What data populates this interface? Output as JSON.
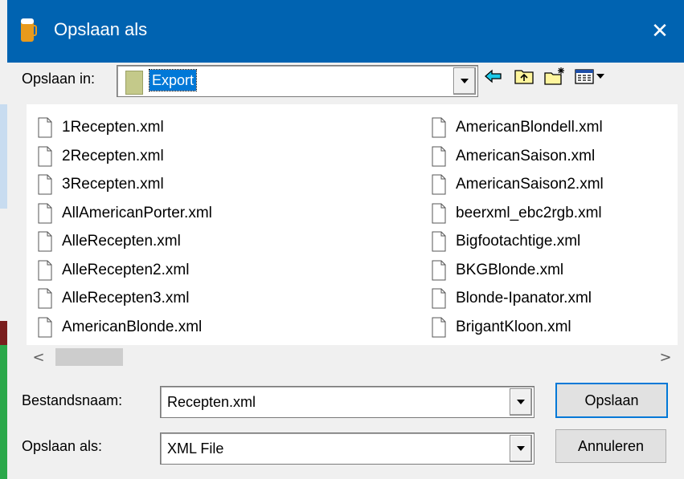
{
  "window": {
    "title": "Opslaan als",
    "close_glyph": "✕"
  },
  "colors": {
    "titlebar": "#0063b1",
    "selection": "#0078d7"
  },
  "location": {
    "label": "Opslaan in:",
    "folder_icon": "folder-icon",
    "current_folder": "Export"
  },
  "toolbar": {
    "icons": [
      "back-arrow-icon",
      "up-folder-icon",
      "new-folder-icon",
      "view-menu-icon"
    ]
  },
  "files": {
    "left": [
      "1Recepten.xml",
      "2Recepten.xml",
      "3Recepten.xml",
      "AllAmericanPorter.xml",
      "AlleRecepten.xml",
      "AlleRecepten2.xml",
      "AlleRecepten3.xml",
      "AmericanBlonde.xml"
    ],
    "right": [
      "AmericanBlondell.xml",
      "AmericanSaison.xml",
      "AmericanSaison2.xml",
      "beerxml_ebc2rgb.xml",
      "Bigfootachtige.xml",
      "BKGBlonde.xml",
      "Blonde-Ipanator.xml",
      "BrigantKloon.xml"
    ]
  },
  "scrollbar": {
    "left_glyph": "<",
    "right_glyph": ">"
  },
  "filename": {
    "label": "Bestandsnaam:",
    "value": "Recepten.xml"
  },
  "filetype": {
    "label": "Opslaan als:",
    "value": "XML File"
  },
  "buttons": {
    "save": "Opslaan",
    "cancel": "Annuleren"
  }
}
